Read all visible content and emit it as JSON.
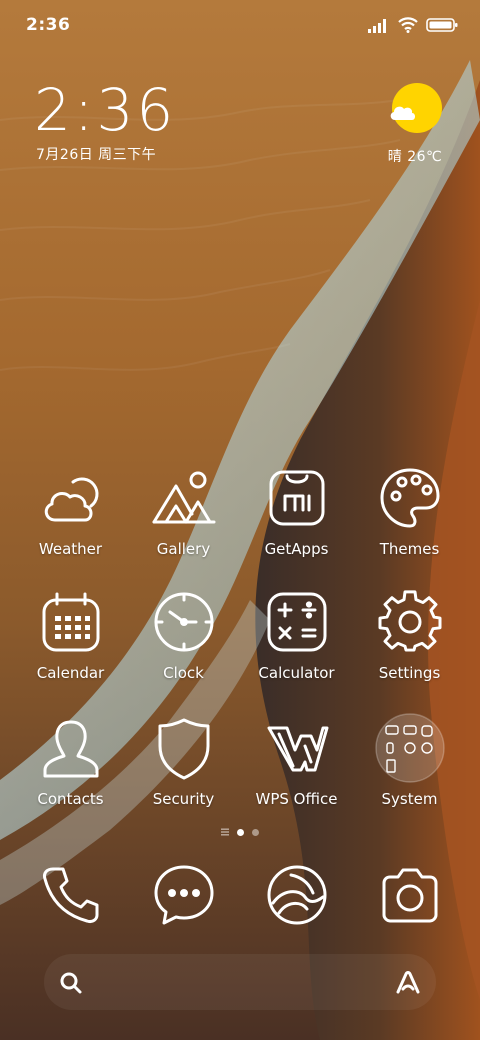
{
  "status_bar": {
    "time": "2:36",
    "icons": [
      "signal-icon",
      "wifi-icon",
      "battery-icon"
    ]
  },
  "clock_widget": {
    "time": "2:36",
    "date": "7月26日 周三下午"
  },
  "weather_widget": {
    "icon": "partly-sunny-icon",
    "text": "晴 26℃"
  },
  "apps": [
    {
      "label": "Weather",
      "icon": "weather-icon"
    },
    {
      "label": "Gallery",
      "icon": "gallery-icon"
    },
    {
      "label": "GetApps",
      "icon": "getapps-icon"
    },
    {
      "label": "Themes",
      "icon": "themes-icon"
    },
    {
      "label": "Calendar",
      "icon": "calendar-icon"
    },
    {
      "label": "Clock",
      "icon": "clock-icon"
    },
    {
      "label": "Calculator",
      "icon": "calculator-icon"
    },
    {
      "label": "Settings",
      "icon": "settings-icon"
    },
    {
      "label": "Contacts",
      "icon": "contacts-icon"
    },
    {
      "label": "Security",
      "icon": "security-icon"
    },
    {
      "label": "WPS Office",
      "icon": "wps-office-icon"
    },
    {
      "label": "System",
      "icon": "system-folder-icon"
    }
  ],
  "page_indicator": {
    "pages": 2,
    "current": 1
  },
  "dock": [
    {
      "icon": "phone-icon"
    },
    {
      "icon": "messages-icon"
    },
    {
      "icon": "browser-icon"
    },
    {
      "icon": "camera-icon"
    }
  ],
  "search_bar": {
    "left_icon": "search-icon",
    "right_icon": "assistant-icon"
  },
  "colors": {
    "sun": "#FFD400",
    "icon_stroke": "#ffffff"
  }
}
